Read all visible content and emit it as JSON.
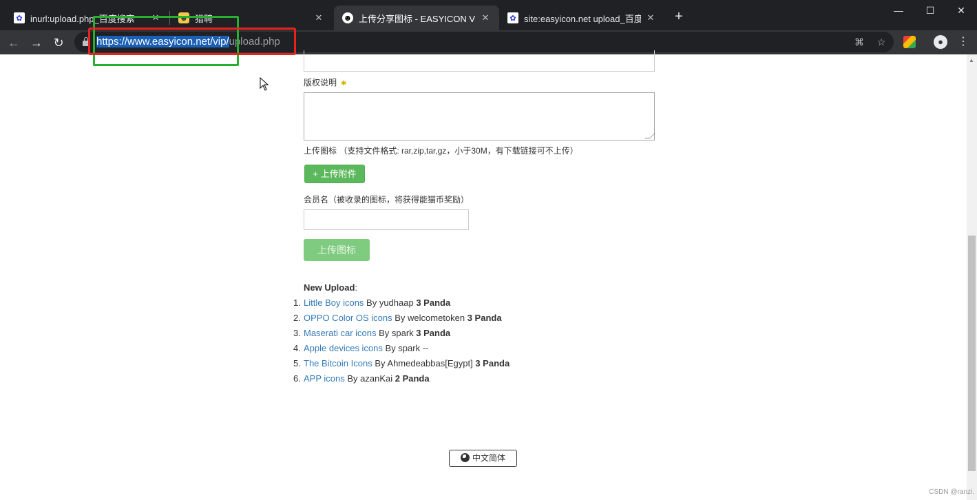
{
  "browser": {
    "tabs": [
      {
        "title": "inurl:upload.php_百度搜索",
        "favicon": "baidu-icon"
      },
      {
        "title": "猎聘",
        "favicon": "panda-icon"
      },
      {
        "title": "上传分享图标 - EASYICON VIP",
        "favicon": "panda-icon"
      },
      {
        "title": "site:easyicon.net upload_百度搜",
        "favicon": "baidu-icon"
      }
    ],
    "url_selected": "https://www.easyicon.net/vip/",
    "url_rest": "upload.php",
    "close_glyph": "✕",
    "new_tab_glyph": "+"
  },
  "form": {
    "copyright_label": "版权说明",
    "required_mark": "✱",
    "upload_icon_label": "上传图标 （支持文件格式: rar,zip,tar,gz，小于30M，有下载链接可不上传）",
    "attach_button": "+ 上传附件",
    "member_label": "会员名（被收录的图标，将获得能猫币奖励）",
    "submit_button": "上传图标"
  },
  "new_upload": {
    "title": "New Upload",
    "colon": ":",
    "items": [
      {
        "num": "1.",
        "link": "Little Boy icons",
        "by": " By yudhaap ",
        "reward": "3 Panda"
      },
      {
        "num": "2.",
        "link": "OPPO Color OS icons",
        "by": " By welcometoken ",
        "reward": "3 Panda"
      },
      {
        "num": "3.",
        "link": "Maserati car icons",
        "by": " By spark ",
        "reward": "3 Panda"
      },
      {
        "num": "4.",
        "link": "Apple devices icons",
        "by": " By spark --",
        "reward": ""
      },
      {
        "num": "5.",
        "link": "The Bitcoin Icons",
        "by": " By Ahmedeabbas[Egypt] ",
        "reward": "3 Panda"
      },
      {
        "num": "6.",
        "link": "APP icons",
        "by": " By azanKai ",
        "reward": "2 Panda"
      }
    ]
  },
  "footer": {
    "language": "中文简体",
    "watermark": "CSDN @ranzi."
  },
  "colors": {
    "annotation_red": "#e8231d",
    "annotation_green": "#27b030",
    "button_green": "#5cb85c",
    "link_blue": "#337ab7"
  }
}
